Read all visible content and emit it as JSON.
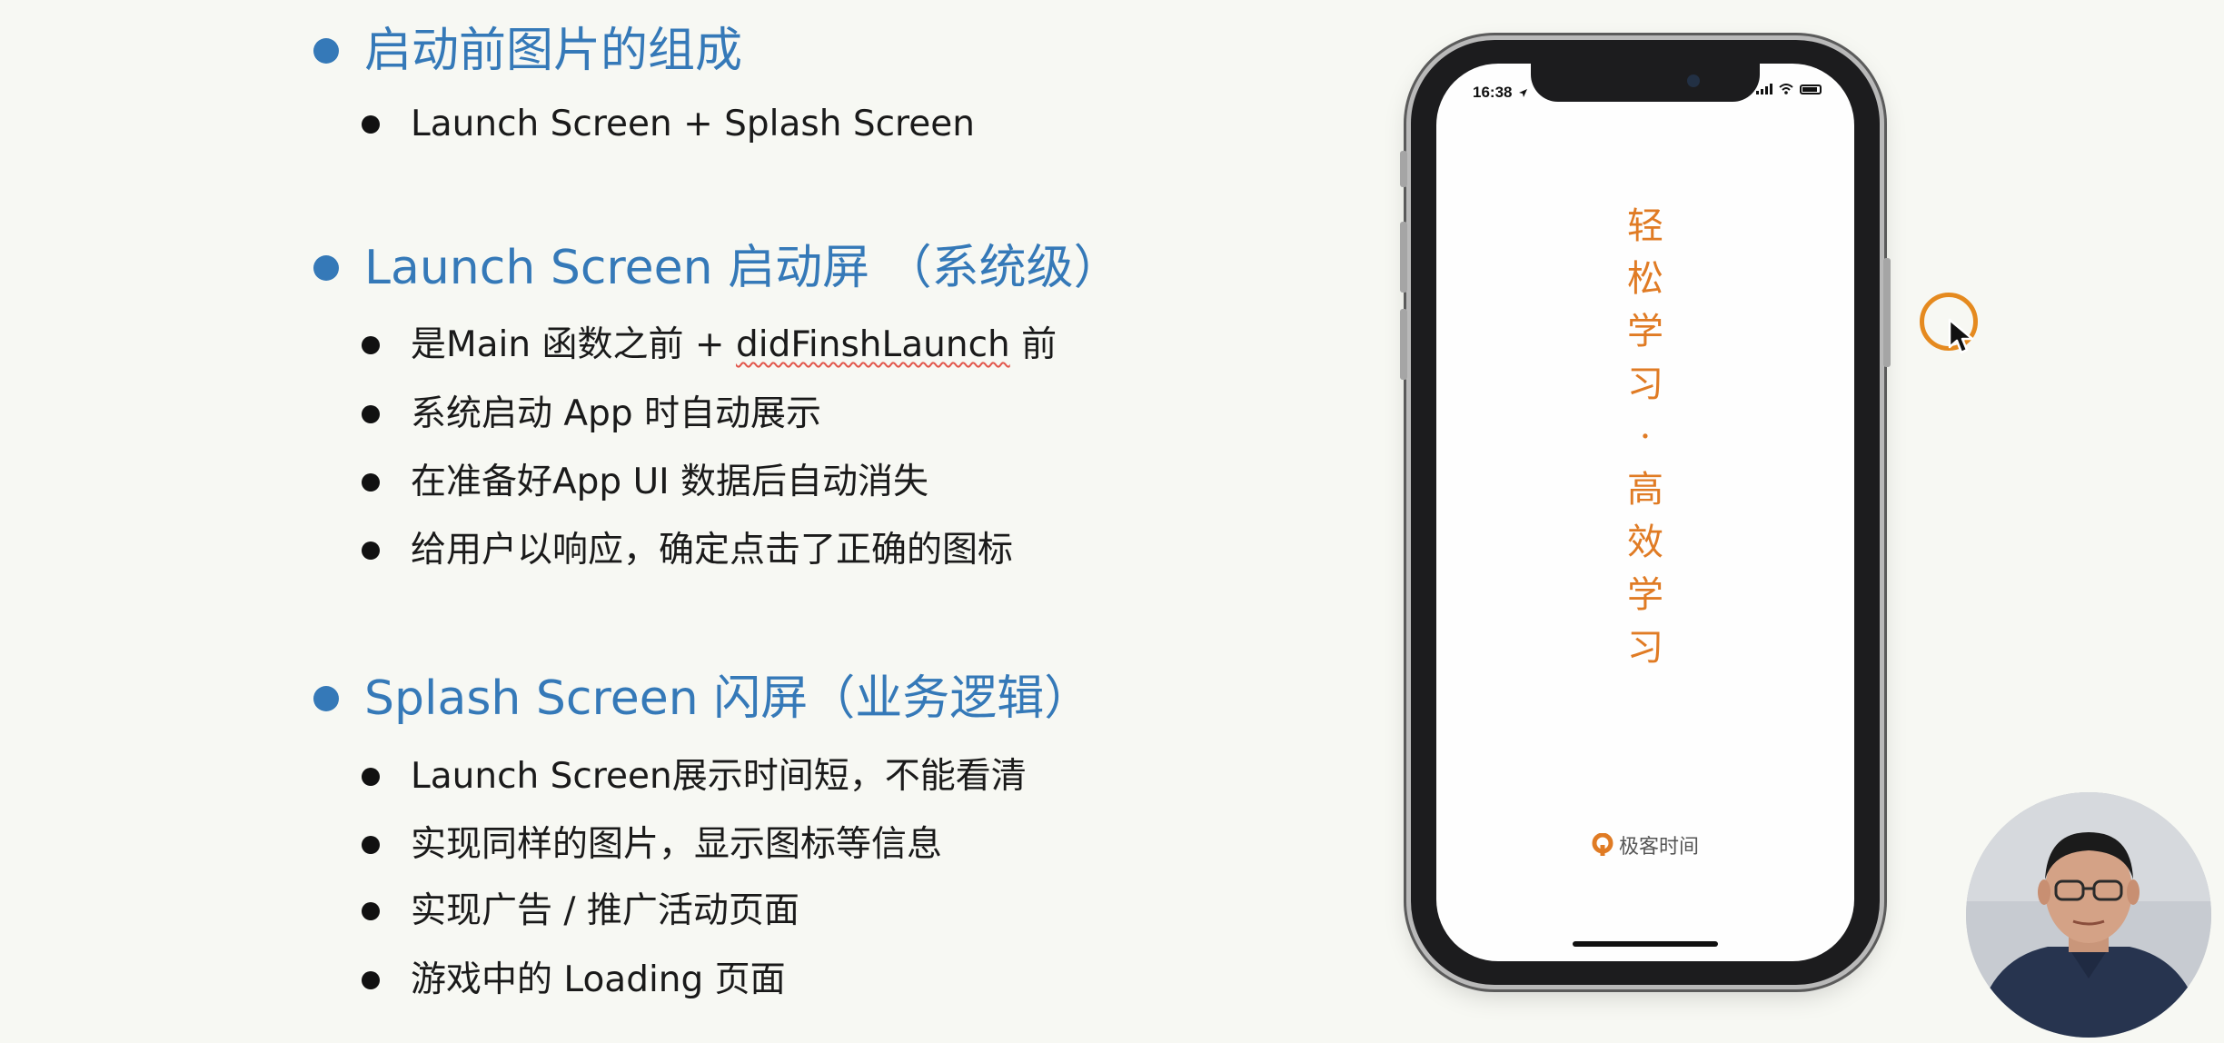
{
  "sections": [
    {
      "title": "启动前图片的组成",
      "items": [
        "Launch Screen + Splash Screen"
      ]
    },
    {
      "title": "Launch Screen 启动屏 （系统级）",
      "items": [
        {
          "before": "是Main 函数之前 + ",
          "squiggle": "didFinshLaunch",
          "after": " 前"
        },
        "系统启动 App 时自动展示",
        "在准备好App UI 数据后自动消失",
        "给用户以响应，确定点击了正确的图标"
      ]
    },
    {
      "title": "Splash Screen 闪屏（业务逻辑）",
      "items": [
        "Launch Screen展示时间短，不能看清",
        "实现同样的图片，显示图标等信息",
        "实现广告 / 推广活动页面",
        "游戏中的 Loading 页面"
      ]
    }
  ],
  "phone": {
    "status_time": "16:38",
    "vertical_text": [
      "轻",
      "松",
      "学",
      "习",
      "·",
      "高",
      "效",
      "学",
      "习"
    ],
    "brand_text": "极客时间",
    "accent_color": "#e07b24"
  },
  "colors": {
    "section_title": "#3579b8",
    "cursor_ring": "#e58a1f"
  },
  "icons": {
    "cursor": "arrow-cursor-icon",
    "brand_logo": "geektime-logo-icon"
  }
}
